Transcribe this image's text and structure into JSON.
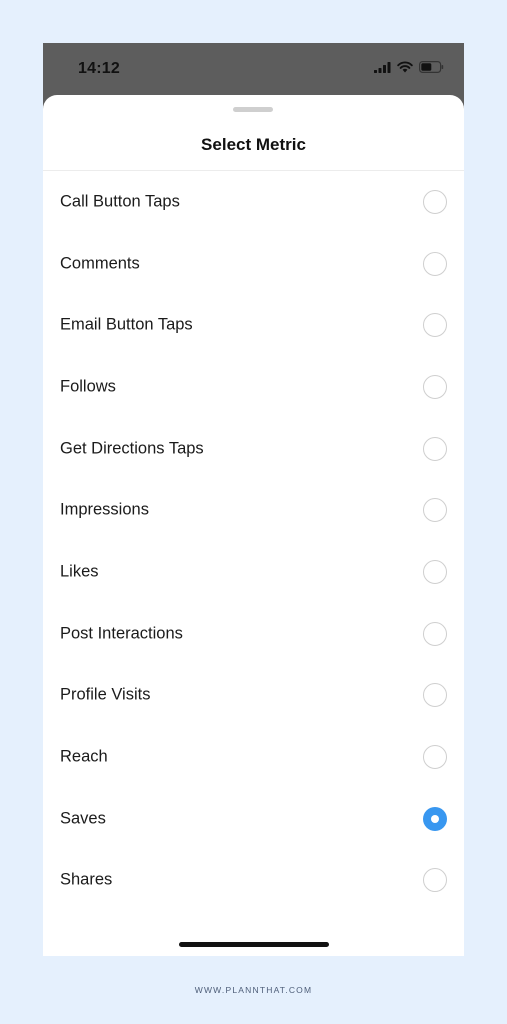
{
  "status_bar": {
    "time": "14:12",
    "icons": [
      "signal-icon",
      "wifi-icon",
      "battery-icon"
    ]
  },
  "sheet": {
    "title": "Select Metric"
  },
  "metrics": [
    {
      "label": "Call Button Taps",
      "selected": false
    },
    {
      "label": "Comments",
      "selected": false
    },
    {
      "label": "Email Button Taps",
      "selected": false
    },
    {
      "label": "Follows",
      "selected": false
    },
    {
      "label": "Get Directions Taps",
      "selected": false
    },
    {
      "label": "Impressions",
      "selected": false
    },
    {
      "label": "Likes",
      "selected": false
    },
    {
      "label": "Post Interactions",
      "selected": false
    },
    {
      "label": "Profile Visits",
      "selected": false
    },
    {
      "label": "Reach",
      "selected": false
    },
    {
      "label": "Saves",
      "selected": true
    },
    {
      "label": "Shares",
      "selected": false
    }
  ],
  "footer": {
    "url": "WWW.PLANNTHAT.COM"
  },
  "colors": {
    "accent": "#3897f0",
    "page_background": "#e5f0fd",
    "status_bar_background": "#5d5d5d"
  }
}
